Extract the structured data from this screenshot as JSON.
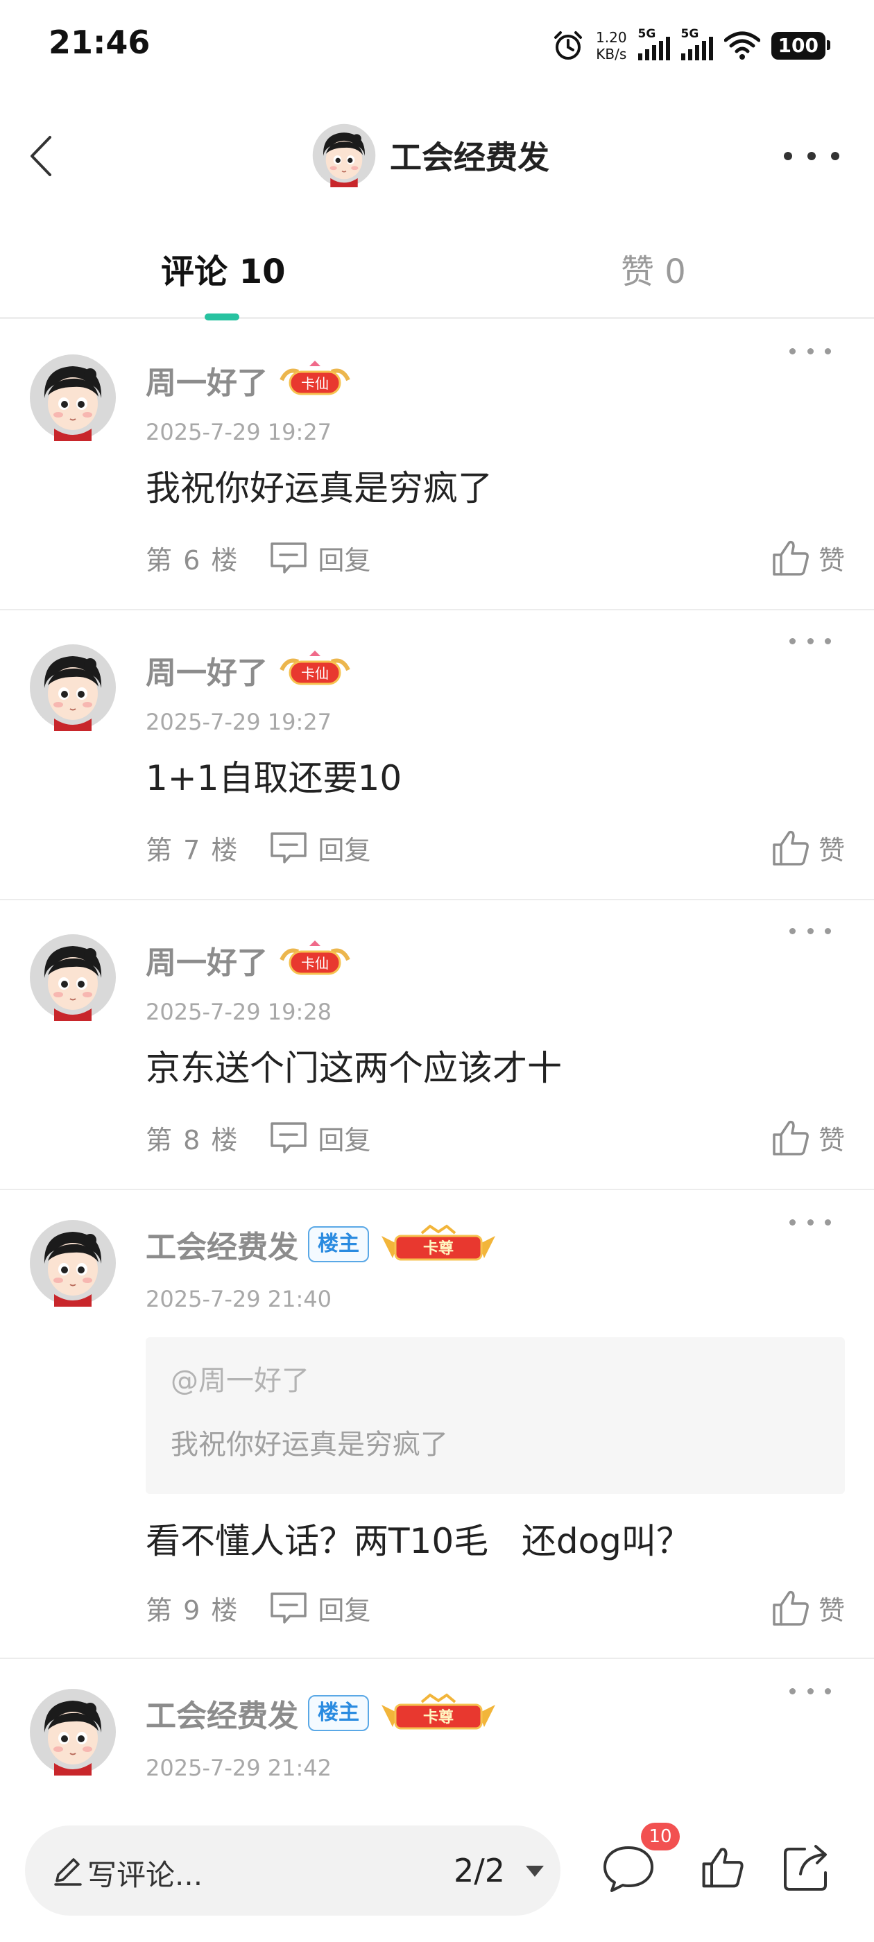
{
  "status_bar": {
    "time": "21:46",
    "speed_value": "1.20",
    "speed_unit": "KB/s",
    "sim1": "5G",
    "sim2": "5G",
    "battery": "100"
  },
  "header": {
    "title": "工会经费发"
  },
  "tabs": {
    "comments": "评论 10",
    "likes": "赞 0"
  },
  "badges": {
    "fan_level": "卡仙",
    "vip_level": "卡尊",
    "op_label": "楼主"
  },
  "comments": [
    {
      "name": "周一好了",
      "time": "2025-7-29 19:27",
      "text": "我祝你好运真是穷疯了",
      "floor": "第 6 楼",
      "reply": "回复",
      "like": "赞"
    },
    {
      "name": "周一好了",
      "time": "2025-7-29 19:27",
      "text": "1+1自取还要10",
      "floor": "第 7 楼",
      "reply": "回复",
      "like": "赞"
    },
    {
      "name": "周一好了",
      "time": "2025-7-29 19:28",
      "text": "京东送个门这两个应该才十",
      "floor": "第 8 楼",
      "reply": "回复",
      "like": "赞"
    },
    {
      "name": "工会经费发",
      "time": "2025-7-29 21:40",
      "quote_user": "@周一好了",
      "quote_text": "我祝你好运真是穷疯了",
      "text": "看不懂人话？两T10毛   还dog叫？",
      "floor": "第 9 楼",
      "reply": "回复",
      "like": "赞"
    },
    {
      "name": "工会经费发",
      "time": "2025-7-29 21:42"
    }
  ],
  "bottom_bar": {
    "write_placeholder": "写评论...",
    "page_indicator": "2/2",
    "comment_count_badge": "10"
  },
  "colors": {
    "accent": "#27c2a0",
    "badge_red": "#f25151",
    "op_blue": "#2a8be0"
  }
}
